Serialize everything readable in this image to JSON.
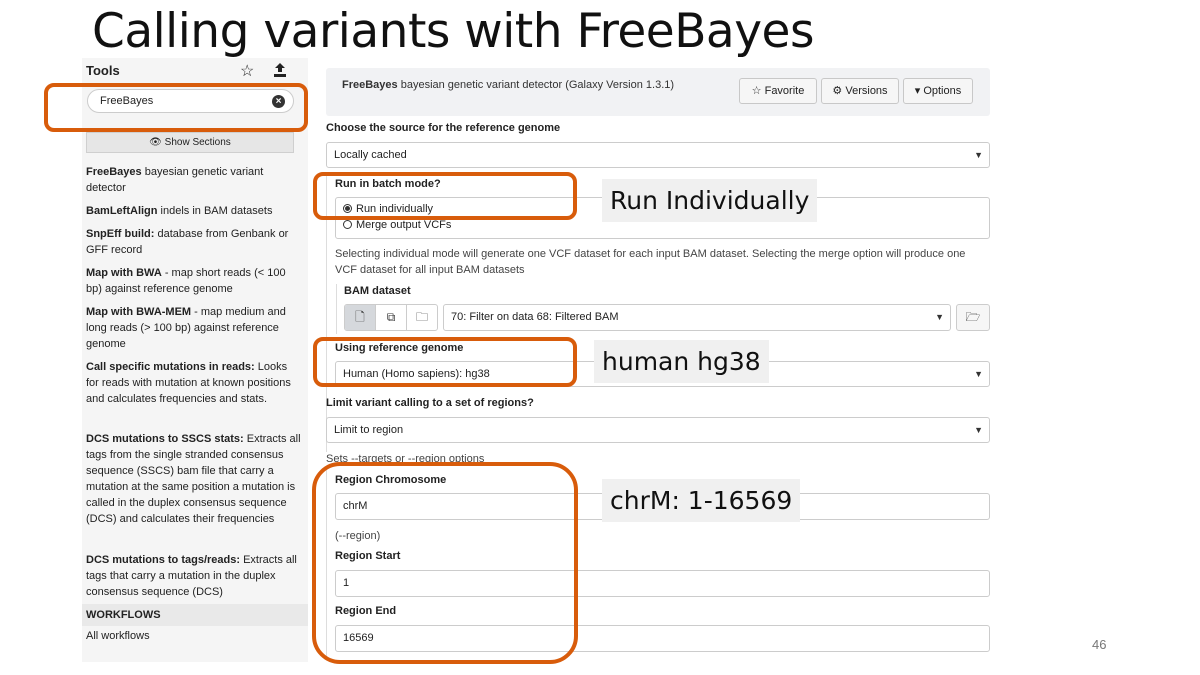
{
  "slide": {
    "title": "Calling variants with FreeBayes",
    "page_number": "46"
  },
  "tool_panel": {
    "title": "Tools",
    "star_icon": "star-icon",
    "upload_icon": "upload-icon",
    "search": {
      "value": "FreeBayes"
    },
    "show_sections": "Show Sections",
    "items": [
      {
        "name": "FreeBayes",
        "desc": " bayesian genetic variant detector"
      },
      {
        "name": "BamLeftAlign",
        "desc": " indels in BAM datasets"
      },
      {
        "name": "SnpEff build:",
        "desc": " database from Genbank or GFF record"
      },
      {
        "name": "Map with BWA",
        "desc": " - map short reads (< 100 bp) against reference genome"
      },
      {
        "name": "Map with BWA-MEM",
        "desc": " - map medium and long reads (> 100 bp) against reference genome"
      },
      {
        "name": "Call specific mutations in reads:",
        "desc": " Looks for reads with mutation at known positions and calculates frequencies and stats."
      },
      {
        "name": "DCS mutations to SSCS stats:",
        "desc": " Extracts all tags from the single stranded consensus sequence (SSCS) bam file that carry a mutation at the same position a mutation is called in the duplex consensus sequence (DCS) and calculates their frequencies"
      },
      {
        "name": "DCS mutations to tags/reads:",
        "desc": " Extracts all tags that carry a mutation in the duplex consensus sequence (DCS)"
      }
    ],
    "workflows_header": "WORKFLOWS",
    "all_workflows": "All workflows"
  },
  "tool_form": {
    "name": "FreeBayes",
    "description": " bayesian genetic variant detector (Galaxy Version 1.3.1)",
    "buttons": {
      "favorite": "Favorite",
      "versions": "Versions",
      "options": "Options"
    },
    "ref_source_label": "Choose the source for the reference genome",
    "ref_source_value": "Locally cached",
    "batch_label": "Run in batch mode?",
    "batch_options": [
      "Run individually",
      "Merge output VCFs"
    ],
    "batch_help": "Selecting individual mode will generate one VCF dataset for each input BAM dataset. Selecting the merge option will produce one VCF dataset for all input BAM datasets",
    "bam_label": "BAM dataset",
    "bam_value": "70: Filter on data 68: Filtered BAM",
    "ref_genome_label": "Using reference genome",
    "ref_genome_value": "Human (Homo sapiens): hg38",
    "limit_label": "Limit variant calling to a set of regions?",
    "limit_value": "Limit to region",
    "limit_help": "Sets --targets or --region options",
    "region_chrom_label": "Region Chromosome",
    "region_chrom_value": "chrM",
    "region_chrom_help": "(--region)",
    "region_start_label": "Region Start",
    "region_start_value": "1",
    "region_end_label": "Region End",
    "region_end_value": "16569"
  },
  "annotations": {
    "batch": "Run Individually",
    "genome": "human hg38",
    "region": "chrM: 1-16569"
  },
  "colors": {
    "highlight": "#d85c0b",
    "callout_bg": "#f0f0f0"
  }
}
